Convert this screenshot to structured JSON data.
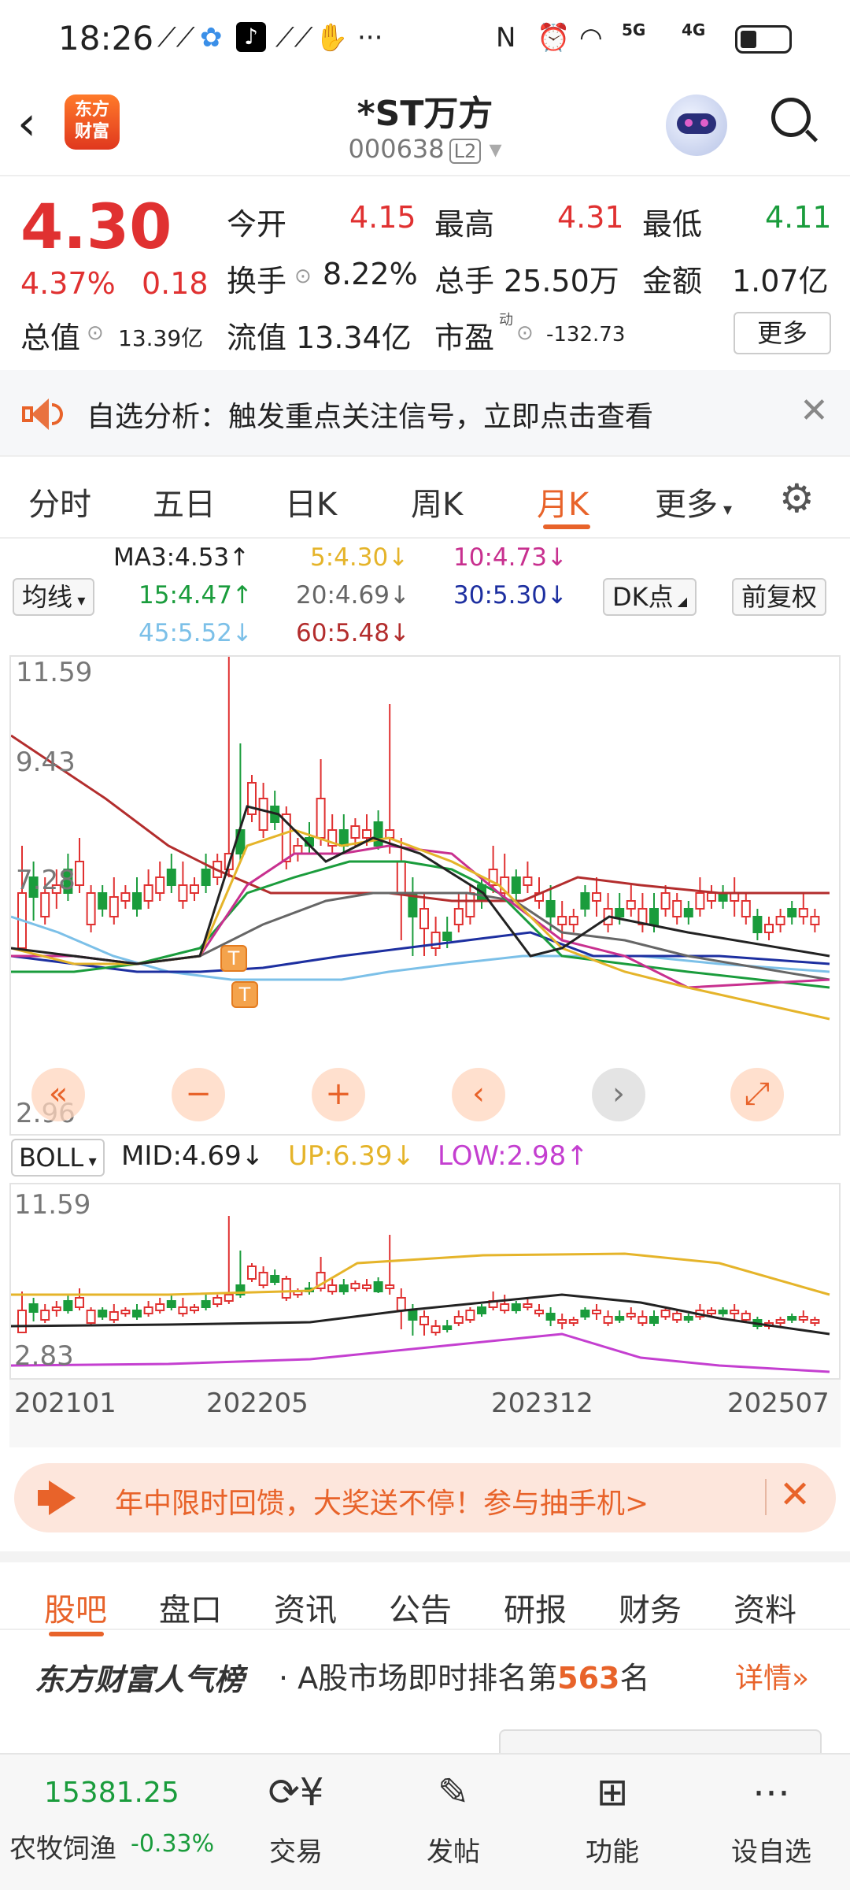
{
  "status_bar": {
    "time": "18:26",
    "network": "5G",
    "network2": "4G"
  },
  "header": {
    "title": "*ST万方",
    "code": "000638",
    "level": "L2"
  },
  "quote": {
    "price": "4.30",
    "change_pct": "4.37%",
    "change": "0.18",
    "fields": [
      {
        "label": "今开",
        "value": "4.15"
      },
      {
        "label": "最高",
        "value": "4.31"
      },
      {
        "label": "最低",
        "value": "4.11"
      },
      {
        "label": "换手",
        "value": "8.22%"
      },
      {
        "label": "总手",
        "value": "25.50万"
      },
      {
        "label": "金额",
        "value": "1.07亿"
      },
      {
        "label": "总值",
        "value": "13.39亿"
      },
      {
        "label": "流值",
        "value": "13.34亿"
      },
      {
        "label": "市盈",
        "value": "-132.73",
        "sup": "动"
      }
    ],
    "more_label": "更多"
  },
  "notice": {
    "text": "自选分析：触发重点关注信号，立即点击查看"
  },
  "tabs": [
    "分时",
    "五日",
    "日K",
    "周K",
    "月K",
    "更多"
  ],
  "active_tab": "月K",
  "ma": {
    "dropdown": "均线",
    "items": [
      "MA3:4.53",
      "5:4.30",
      "10:4.73",
      "15:4.47",
      "20:4.69",
      "30:5.30",
      "45:5.52",
      "60:5.48"
    ],
    "dk_label": "DK点",
    "adjust_label": "前复权"
  },
  "chart_axis": {
    "y_top": "11.59",
    "y2": "9.43",
    "y3": "7.28",
    "y_bottom": "2.96"
  },
  "boll": {
    "dropdown": "BOLL",
    "mid": "MID:4.69",
    "up": "UP:6.39",
    "low": "LOW:2.98",
    "y_top": "11.59",
    "y_bottom": "2.83"
  },
  "x_labels": [
    "202101",
    "202205",
    "202312",
    "202507"
  ],
  "promo": {
    "text": "年中限时回馈，大奖送不停！参与抽手机>"
  },
  "subtabs": [
    "股吧",
    "盘口",
    "资讯",
    "公告",
    "研报",
    "财务",
    "资料"
  ],
  "rank": {
    "brand": "东方财富人气榜",
    "text_pre": "A股市场即时排名第",
    "rank": "563",
    "text_post": "名",
    "detail": "详情"
  },
  "bottom_nav": {
    "index_value": "15381.25",
    "index_name": "农牧饲渔",
    "index_change": "-0.33%",
    "items": [
      "交易",
      "发帖",
      "功能",
      "设自选"
    ]
  },
  "colors": {
    "accent": "#e8632a",
    "up": "#e03131",
    "down": "#1a9c3c"
  }
}
